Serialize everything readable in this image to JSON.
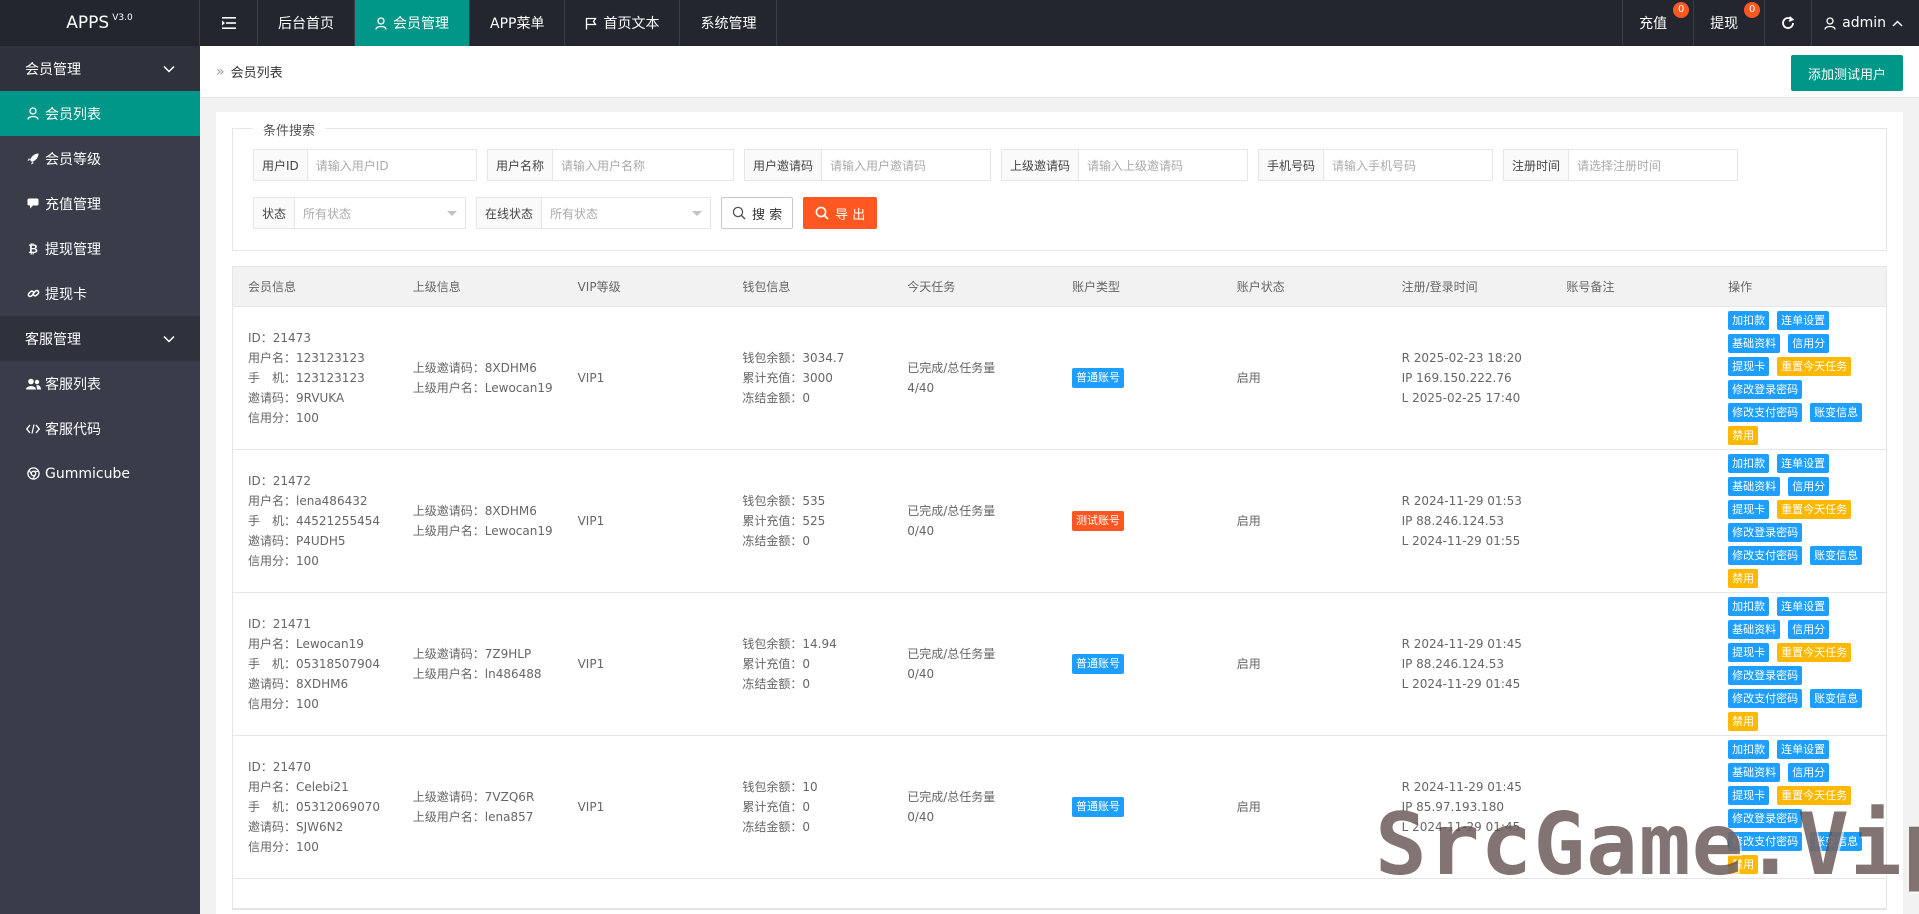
{
  "app": {
    "logo": "APPS",
    "version": "V3.0"
  },
  "topnav": {
    "items": [
      {
        "label": "后台首页",
        "icon": ""
      },
      {
        "label": "会员管理",
        "icon": "user-icon"
      },
      {
        "label": "APP菜单",
        "icon": ""
      },
      {
        "label": "首页文本",
        "icon": "flag-icon"
      },
      {
        "label": "系统管理",
        "icon": ""
      }
    ],
    "active_index": 1,
    "right": {
      "recharge_label": "充值",
      "recharge_count": "0",
      "withdraw_label": "提现",
      "withdraw_count": "0",
      "user_label": "admin"
    }
  },
  "sidebar": {
    "groups": [
      {
        "label": "会员管理",
        "items": [
          {
            "label": "会员列表",
            "icon": "user-icon",
            "active": true
          },
          {
            "label": "会员等级",
            "icon": "rocket-icon"
          },
          {
            "label": "充值管理",
            "icon": "chat-icon"
          },
          {
            "label": "提现管理",
            "icon": "bitcoin-icon"
          },
          {
            "label": "提现卡",
            "icon": "link-icon"
          }
        ]
      },
      {
        "label": "客服管理",
        "items": [
          {
            "label": "客服列表",
            "icon": "users-icon"
          },
          {
            "label": "客服代码",
            "icon": "code-icon"
          },
          {
            "label": "Gummicube",
            "icon": "chrome-icon"
          }
        ]
      }
    ]
  },
  "breadcrumb": {
    "current": "会员列表"
  },
  "add_test_user_button": "添加测试用户",
  "search": {
    "legend": "条件搜索",
    "fields": [
      {
        "label": "用户ID",
        "placeholder": "请输入用户ID"
      },
      {
        "label": "用户名称",
        "placeholder": "请输入用户名称"
      },
      {
        "label": "用户邀请码",
        "placeholder": "请输入用户邀请码"
      },
      {
        "label": "上级邀请码",
        "placeholder": "请输入上级邀请码"
      },
      {
        "label": "手机号码",
        "placeholder": "请输入手机号码"
      },
      {
        "label": "注册时间",
        "placeholder": "请选择注册时间"
      }
    ],
    "selects": [
      {
        "label": "状态",
        "value": "所有状态"
      },
      {
        "label": "在线状态",
        "value": "所有状态"
      }
    ],
    "search_button": "搜 索",
    "export_button": "导 出"
  },
  "table": {
    "headers": [
      "会员信息",
      "上级信息",
      "VIP等级",
      "钱包信息",
      "今天任务",
      "账户类型",
      "账户状态",
      "注册/登录时间",
      "账号备注",
      "操作"
    ],
    "rows": [
      {
        "member": [
          "ID：21473",
          "用户名：123123123",
          "手　机：123123123",
          "邀请码：9RVUKA",
          "信用分：100"
        ],
        "parent": [
          "上级邀请码：8XDHM6",
          "上级用户名：Lewocan19"
        ],
        "vip": "VIP1",
        "wallet": [
          "钱包余额：3034.7",
          "累计充值：3000",
          "冻结金额：0"
        ],
        "task": [
          "已完成/总任务量",
          "4/40"
        ],
        "type": "普通账号",
        "type_color": "#1e9fff",
        "status": "启用",
        "times": [
          "R 2025-02-23 18:20",
          "IP 169.150.222.76",
          "L 2025-02-25 17:40"
        ],
        "remark": ""
      },
      {
        "member": [
          "ID：21472",
          "用户名：lena486432",
          "手　机：44521255454",
          "邀请码：P4UDH5",
          "信用分：100"
        ],
        "parent": [
          "上级邀请码：8XDHM6",
          "上级用户名：Lewocan19"
        ],
        "vip": "VIP1",
        "wallet": [
          "钱包余额：535",
          "累计充值：525",
          "冻结金额：0"
        ],
        "task": [
          "已完成/总任务量",
          "0/40"
        ],
        "type": "测试账号",
        "type_color": "#ff5722",
        "status": "启用",
        "times": [
          "R 2024-11-29 01:53",
          "IP 88.246.124.53",
          "L 2024-11-29 01:55"
        ],
        "remark": ""
      },
      {
        "member": [
          "ID：21471",
          "用户名：Lewocan19",
          "手　机：05318507904",
          "邀请码：8XDHM6",
          "信用分：100"
        ],
        "parent": [
          "上级邀请码：7Z9HLP",
          "上级用户名：ln486488"
        ],
        "vip": "VIP1",
        "wallet": [
          "钱包余额：14.94",
          "累计充值：0",
          "冻结金额：0"
        ],
        "task": [
          "已完成/总任务量",
          "0/40"
        ],
        "type": "普通账号",
        "type_color": "#1e9fff",
        "status": "启用",
        "times": [
          "R 2024-11-29 01:45",
          "IP 88.246.124.53",
          "L 2024-11-29 01:45"
        ],
        "remark": ""
      },
      {
        "member": [
          "ID：21470",
          "用户名：Celebi21",
          "手　机：05312069070",
          "邀请码：SJW6N2",
          "信用分：100"
        ],
        "parent": [
          "上级邀请码：7VZQ6R",
          "上级用户名：lena857"
        ],
        "vip": "VIP1",
        "wallet": [
          "钱包余额：10",
          "累计充值：0",
          "冻结金额：0"
        ],
        "task": [
          "已完成/总任务量",
          "0/40"
        ],
        "type": "普通账号",
        "type_color": "#1e9fff",
        "status": "启用",
        "times": [
          "R 2024-11-29 01:45",
          "IP 85.97.193.180",
          "L 2024-11-29 01:45"
        ],
        "remark": ""
      }
    ],
    "operations": [
      {
        "label": "加扣款",
        "color": "blue"
      },
      {
        "label": "连单设置",
        "color": "blue"
      },
      {
        "label": "基础资料",
        "color": "blue"
      },
      {
        "label": "信用分",
        "color": "blue"
      },
      {
        "label": "提现卡",
        "color": "blue"
      },
      {
        "label": "重置今天任务",
        "color": "yellow"
      },
      {
        "label": "修改登录密码",
        "color": "blue"
      },
      {
        "label": "修改支付密码",
        "color": "blue"
      },
      {
        "label": "账变信息",
        "color": "blue"
      },
      {
        "label": "禁用",
        "color": "yellow"
      }
    ]
  },
  "watermark": "SrcGame.Vip",
  "colors": {
    "primary": "#009688",
    "topbar": "#23262e",
    "sidebar": "#393d49",
    "danger": "#ff5722",
    "info": "#1e9fff",
    "warn": "#ffb800"
  }
}
